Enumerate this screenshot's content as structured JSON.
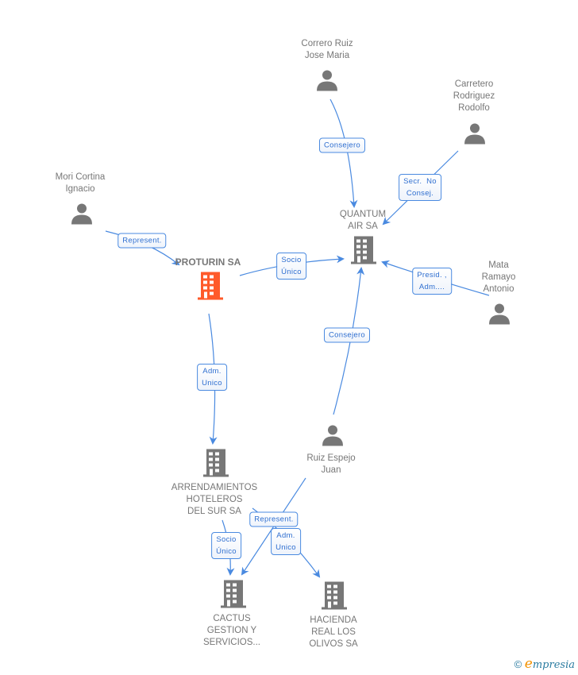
{
  "colors": {
    "edge": "#4a8ae0",
    "node_main": "#ff5a2a",
    "node": "#777777"
  },
  "nodes": [
    {
      "id": "correro",
      "type": "person",
      "lines": [
        "Correro Ruiz",
        "Jose Maria"
      ]
    },
    {
      "id": "carretero",
      "type": "person",
      "lines": [
        "Carretero",
        "Rodriguez",
        "Rodolfo"
      ]
    },
    {
      "id": "mori",
      "type": "person",
      "lines": [
        "Mori Cortina",
        "Ignacio"
      ]
    },
    {
      "id": "quantum",
      "type": "company",
      "lines": [
        "QUANTUM",
        "AIR SA"
      ]
    },
    {
      "id": "proturin",
      "type": "company-main",
      "lines": [
        "PROTURIN SA"
      ]
    },
    {
      "id": "mata",
      "type": "person",
      "lines": [
        "Mata",
        "Ramayo",
        "Antonio"
      ]
    },
    {
      "id": "ruiz",
      "type": "person",
      "lines": [
        "Ruiz Espejo",
        "Juan"
      ]
    },
    {
      "id": "arrend",
      "type": "company",
      "lines": [
        "ARRENDAMIENTOS",
        "HOTELEROS",
        "DEL SUR SA"
      ]
    },
    {
      "id": "cactus",
      "type": "company",
      "lines": [
        "CACTUS",
        "GESTION Y",
        "SERVICIOS..."
      ]
    },
    {
      "id": "hacienda",
      "type": "company",
      "lines": [
        "HACIENDA",
        "REAL LOS",
        "OLIVOS SA"
      ]
    }
  ],
  "edges": [
    {
      "from": "correro",
      "to": "quantum",
      "label": "Consejero"
    },
    {
      "from": "carretero",
      "to": "quantum",
      "label": "Secr.  No\nConsej."
    },
    {
      "from": "mori",
      "to": "proturin",
      "label": "Represent."
    },
    {
      "from": "proturin",
      "to": "quantum",
      "label": "Socio\nÚnico"
    },
    {
      "from": "mata",
      "to": "quantum",
      "label": "Presid. ,\nAdm...."
    },
    {
      "from": "ruiz",
      "to": "quantum",
      "label": "Consejero"
    },
    {
      "from": "proturin",
      "to": "arrend",
      "label": "Adm.\nUnico"
    },
    {
      "from": "arrend",
      "to": "cactus",
      "label": "Socio\nÚnico"
    },
    {
      "from": "ruiz",
      "to": "cactus",
      "label": "Represent."
    },
    {
      "from": "arrend",
      "to": "hacienda",
      "label": "Adm.\nUnico"
    }
  ],
  "footer": {
    "copyright_symbol": "©",
    "brand": "mpresia",
    "brand_initial": "e"
  }
}
